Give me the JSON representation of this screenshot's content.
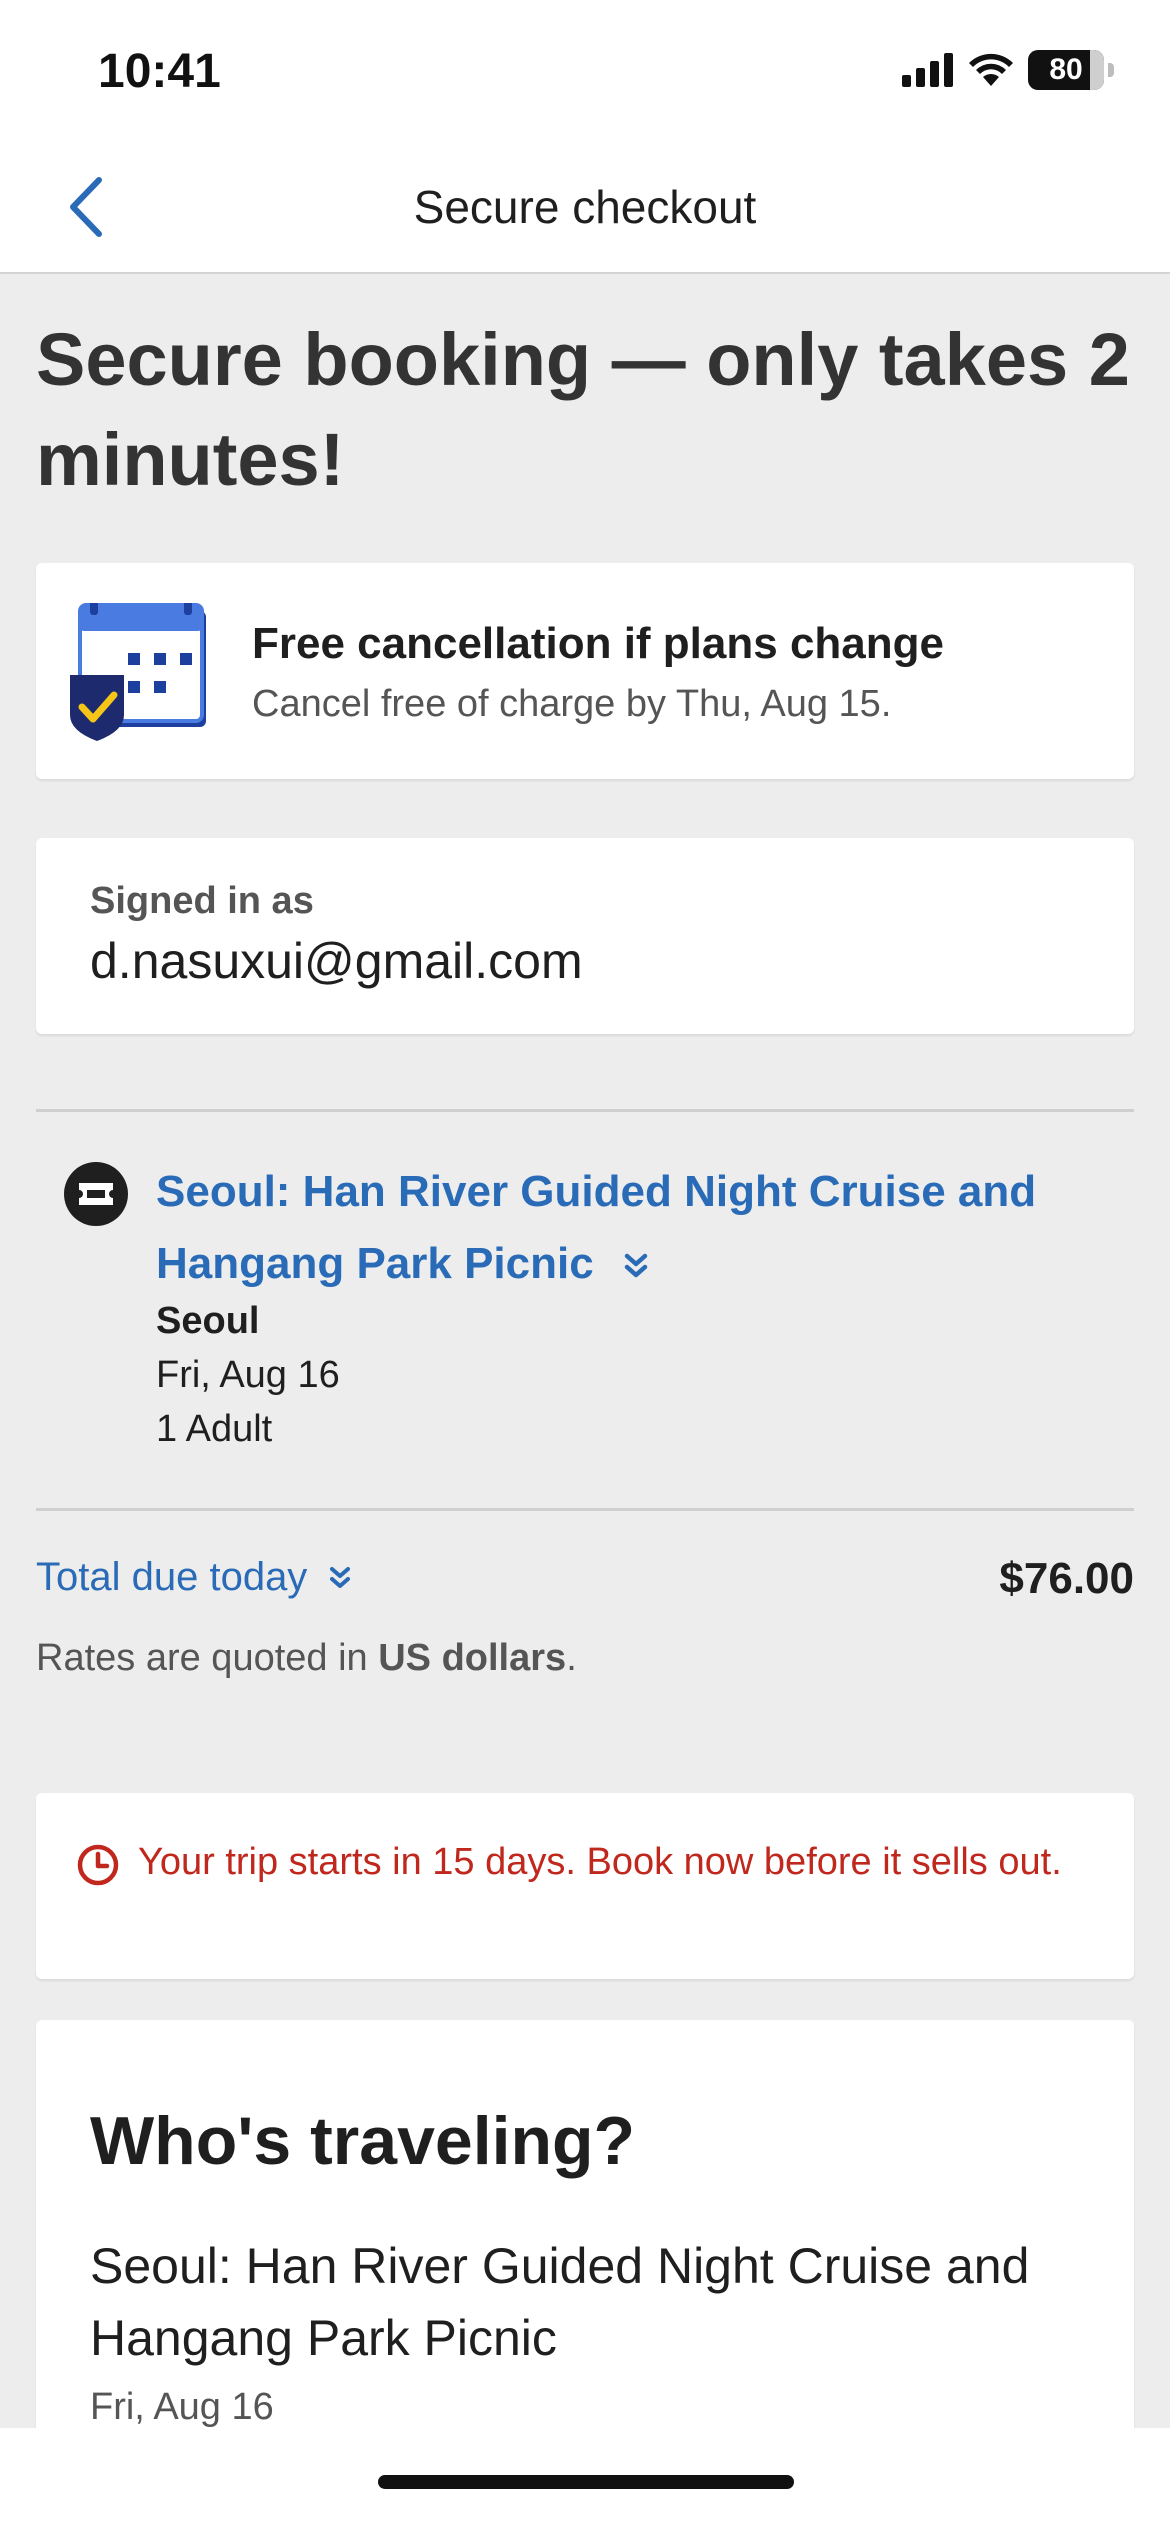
{
  "status_bar": {
    "time": "10:41",
    "battery": "80"
  },
  "nav": {
    "title": "Secure checkout"
  },
  "headline": "Secure booking — only takes 2 minutes!",
  "cancellation": {
    "title": "Free cancellation if plans change",
    "subtitle": "Cancel free of charge by Thu, Aug 15."
  },
  "account": {
    "label": "Signed in as",
    "email": "d.nasuxui@gmail.com"
  },
  "activity": {
    "title": "Seoul: Han River Guided Night Cruise and Hangang Park Picnic",
    "city": "Seoul",
    "date": "Fri, Aug 16",
    "guests": "1 Adult"
  },
  "total": {
    "label": "Total due today",
    "amount": "$76.00",
    "rates_prefix": "Rates are quoted in ",
    "rates_currency": "US dollars",
    "rates_suffix": "."
  },
  "urgency": {
    "message": "Your trip starts in 15 days. Book now before it sells out."
  },
  "travelers": {
    "heading": "Who's traveling?",
    "activity": "Seoul: Han River Guided Night Cruise and Hangang Park Picnic",
    "date": "Fri, Aug 16"
  },
  "colors": {
    "link": "#2a6bb7",
    "urgency": "#c0281e",
    "background": "#ededed"
  }
}
